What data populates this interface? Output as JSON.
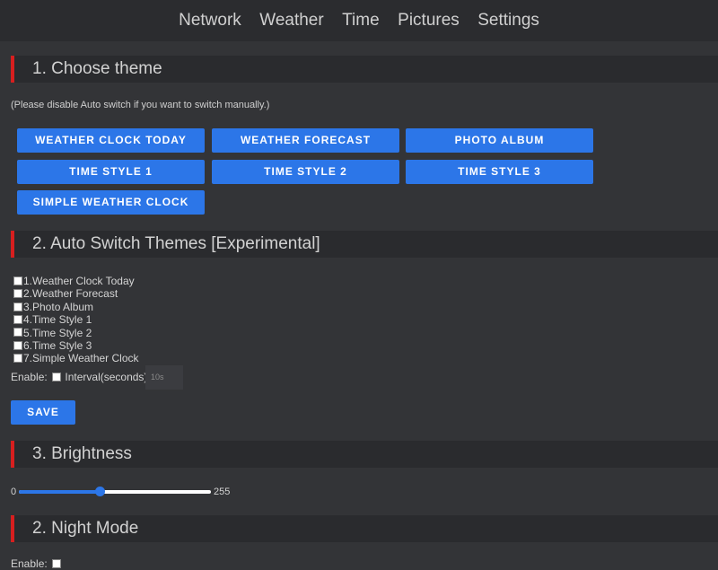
{
  "nav": {
    "items": [
      "Network",
      "Weather",
      "Time",
      "Pictures",
      "Settings"
    ]
  },
  "sections": {
    "choose_theme": {
      "title": "1. Choose theme",
      "note": "(Please disable Auto switch if you want to switch manually.)",
      "buttons": [
        "WEATHER CLOCK TODAY",
        "WEATHER FORECAST",
        "PHOTO ALBUM",
        "TIME STYLE 1",
        "TIME STYLE 2",
        "TIME STYLE 3",
        "SIMPLE WEATHER CLOCK"
      ]
    },
    "auto_switch": {
      "title": "2. Auto Switch Themes [Experimental]",
      "themes": [
        {
          "label": "1.Weather Clock Today",
          "checked": false
        },
        {
          "label": "2.Weather Forecast",
          "checked": false
        },
        {
          "label": "3.Photo Album",
          "checked": false
        },
        {
          "label": "4.Time Style 1",
          "checked": false
        },
        {
          "label": "5.Time Style 2",
          "checked": false
        },
        {
          "label": "6.Time Style 3",
          "checked": false
        },
        {
          "label": "7.Simple Weather Clock",
          "checked": false
        }
      ],
      "enable_label": "Enable:",
      "enable_checked": false,
      "interval_label": "Interval(seconds):",
      "interval_placeholder": "10s",
      "save_label": "SAVE"
    },
    "brightness": {
      "title": "3. Brightness",
      "min_label": "0",
      "max_label": "255",
      "value_fraction": 0.42
    },
    "night_mode": {
      "title": "2. Night Mode",
      "enable_label": "Enable:",
      "enable_checked": false
    }
  },
  "colors": {
    "accent": "#2c76e8",
    "section_marker": "#d71f1f",
    "background": "#333437"
  }
}
